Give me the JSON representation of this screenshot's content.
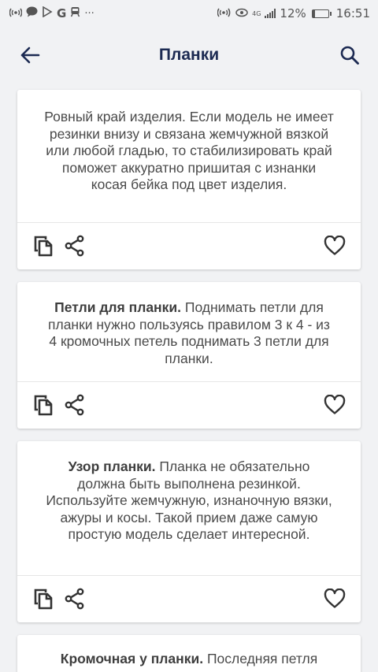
{
  "status_bar": {
    "left_icons": [
      "wifi-hotspot-icon",
      "chat-icon",
      "play-icon",
      "google-icon",
      "train-icon",
      "more-icon"
    ],
    "more": "···",
    "google": "G",
    "network_label": "4G",
    "battery": "12%",
    "time": "16:51"
  },
  "app_bar": {
    "title": "Планки",
    "back_icon": "arrow-left-icon",
    "search_icon": "search-icon",
    "title_color": "#1c2a52"
  },
  "cards": [
    {
      "bold": "",
      "text": "Ровный край изделия. Если модель не имеет резинки внизу и связана жемчужной вязкой или любой гладью, то стабилизировать край поможет аккуратно пришитая с изнанки косая бейка под цвет изделия."
    },
    {
      "bold": "Петли для планки.",
      "text": " Поднимать петли для планки нужно пользуясь правилом 3 к 4 - из 4 кромочных петель поднимать 3 петли для планки."
    },
    {
      "bold": "Узор планки.",
      "text": " Планка не обязательно должна быть выполнена резинкой. Используйте жемчужную, изнаночную вязки, ажуры и косы. Такой прием даже самую простую модель сделает интересной."
    },
    {
      "bold": "Кромочная у планки.",
      "text": " Последняя петля"
    }
  ],
  "card_actions": {
    "copy_icon": "copy-icon",
    "share_icon": "share-icon",
    "favorite_icon": "heart-outline-icon"
  }
}
